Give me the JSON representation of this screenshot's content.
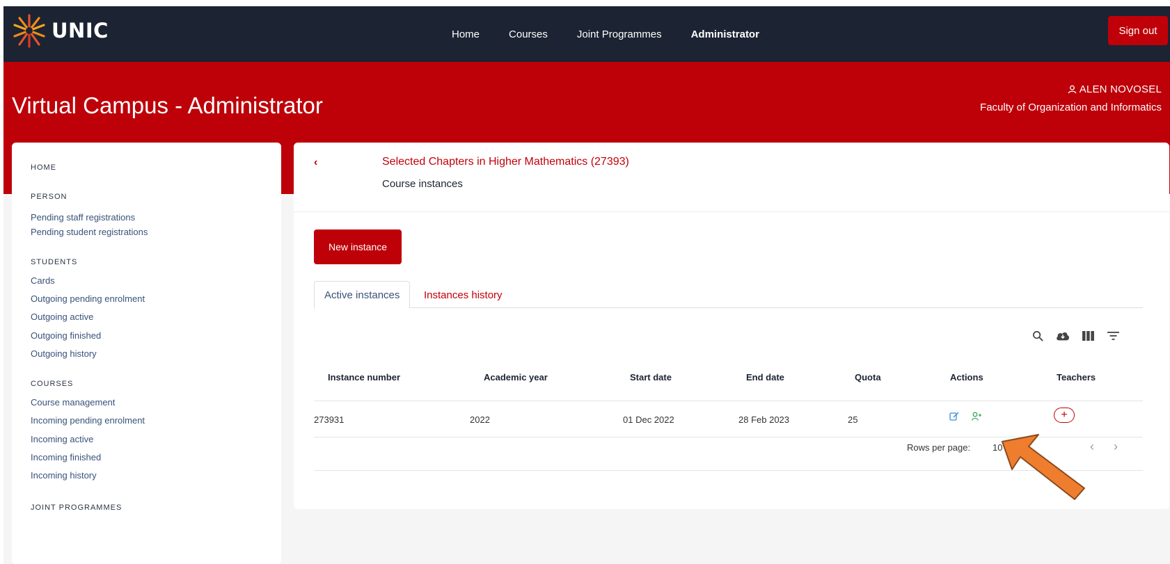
{
  "brand": {
    "name": "UNIC",
    "accent_red": "#be0009",
    "nav_bg": "#1c2332"
  },
  "nav": {
    "links": [
      "Home",
      "Courses",
      "Joint Programmes",
      "Administrator"
    ],
    "active": "Administrator",
    "signout": "Sign out"
  },
  "banner": {
    "title": "Virtual Campus - Administrator",
    "user_name": "ALEN NOVOSEL",
    "user_org": "Faculty of Organization and Informatics"
  },
  "sidebar": {
    "home": "HOME",
    "person": {
      "heading": "PERSON",
      "items": [
        "Pending staff registrations",
        "Pending student registrations"
      ]
    },
    "students": {
      "heading": "STUDENTS",
      "items": [
        "Cards",
        "Outgoing pending enrolment",
        "Outgoing active",
        "Outgoing finished",
        "Outgoing history"
      ]
    },
    "courses": {
      "heading": "COURSES",
      "items": [
        "Course management",
        "Incoming pending enrolment",
        "Incoming active",
        "Incoming finished",
        "Incoming history"
      ]
    },
    "joint": "JOINT PROGRAMMES"
  },
  "main": {
    "course_title": "Selected Chapters in Higher Mathematics (27393)",
    "subtitle": "Course instances",
    "new_button": "New instance",
    "tabs": [
      "Active instances",
      "Instances history"
    ],
    "toolbar_icons": [
      "search-icon",
      "cloud-download-icon",
      "view-columns-icon",
      "filter-icon"
    ],
    "table": {
      "columns": [
        "Instance number",
        "Academic year",
        "Start date",
        "End date",
        "Quota",
        "Actions",
        "Teachers"
      ],
      "rows": [
        {
          "instance": "273931",
          "year": "2022",
          "start": "01 Dec 2022",
          "end": "28 Feb 2023",
          "quota": "25"
        }
      ]
    },
    "pagination": {
      "label": "Rows per page:",
      "value": "10"
    }
  }
}
